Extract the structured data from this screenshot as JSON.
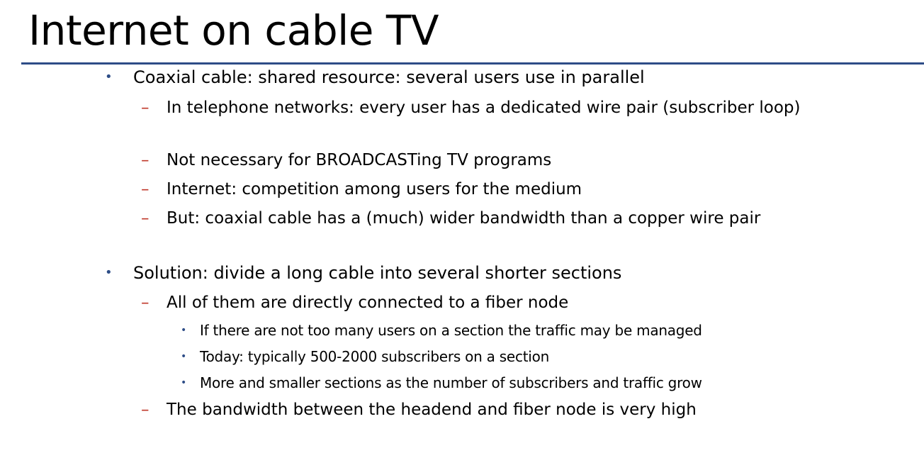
{
  "slide": {
    "title": "Internet on cable TV"
  },
  "colors": {
    "title_rule": "#2e4d87",
    "bullet_level1": "#2e4d87",
    "dash_level2": "#c0392b",
    "bullet_level3": "#2e4d87",
    "text": "#000000"
  },
  "bullets": [
    {
      "marker": "•",
      "text": "Coaxial cable: shared resource: several users use in parallel",
      "children": [
        {
          "marker": "–",
          "text": "In telephone networks: every user has a dedicated wire pair (subscriber loop)"
        },
        {
          "marker": "–",
          "text": "Not necessary for BROADCASTing TV programs"
        },
        {
          "marker": "–",
          "text": "Internet: competition among users for the medium"
        },
        {
          "marker": "–",
          "text": "But: coaxial cable has a (much) wider bandwidth than a copper wire pair"
        }
      ]
    },
    {
      "marker": "•",
      "text": "Solution: divide a long cable into several shorter sections",
      "children": [
        {
          "marker": "–",
          "text": "All of them are directly connected to a fiber node",
          "children": [
            {
              "marker": "•",
              "text": "If there are not too many users on a section the traffic may be managed"
            },
            {
              "marker": "•",
              "text": "Today: typically 500-2000 subscribers on a section"
            },
            {
              "marker": "•",
              "text": "More and smaller sections as the number of subscribers and traffic grow"
            }
          ]
        },
        {
          "marker": "–",
          "text": "The bandwidth between the headend and fiber node is very high"
        }
      ]
    }
  ]
}
